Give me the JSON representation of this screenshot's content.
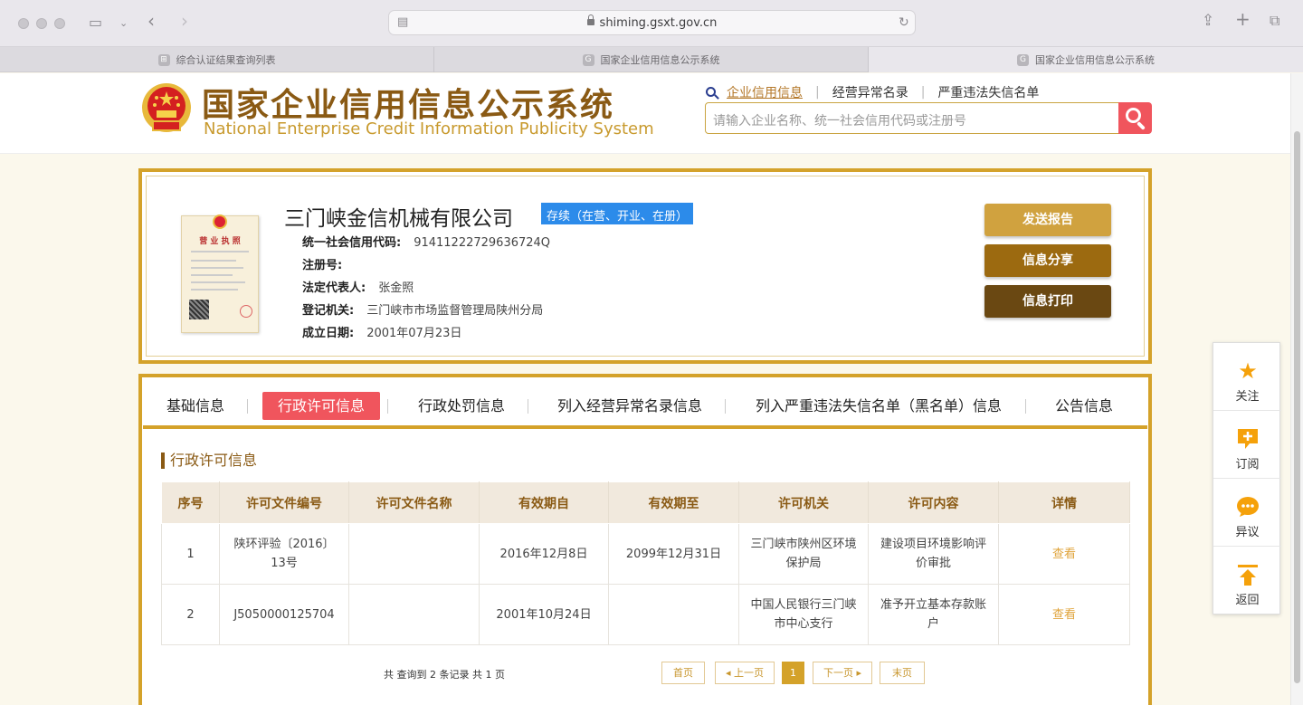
{
  "browser": {
    "url": "shiming.gsxt.gov.cn",
    "tabs": [
      {
        "label": "综合认证结果查询列表",
        "fav": "⊞"
      },
      {
        "label": "国家企业信用信息公示系统",
        "fav": "G"
      },
      {
        "label": "国家企业信用信息公示系统",
        "fav": "G"
      }
    ]
  },
  "header": {
    "logo_cn": "国家企业信用信息公示系统",
    "logo_en": "National Enterprise Credit Information Publicity System",
    "nav": [
      "企业信用信息",
      "经营异常名录",
      "严重违法失信名单"
    ],
    "search_placeholder": "请输入企业名称、统一社会信用代码或注册号"
  },
  "company": {
    "name": "三门峡金信机械有限公司",
    "status": "存续（在营、开业、在册）",
    "fields": [
      {
        "label": "统一社会信用代码:",
        "value": "91411222729636724Q"
      },
      {
        "label": "注册号:",
        "value": ""
      },
      {
        "label": "法定代表人:",
        "value": "张金照"
      },
      {
        "label": "登记机关:",
        "value": "三门峡市市场监督管理局陕州分局"
      },
      {
        "label": "成立日期:",
        "value": "2001年07月23日"
      }
    ],
    "license_title": "营 业 执 照",
    "actions": [
      "发送报告",
      "信息分享",
      "信息打印"
    ]
  },
  "tabs": [
    "基础信息",
    "行政许可信息",
    "行政处罚信息",
    "列入经营异常名录信息",
    "列入严重违法失信名单（黑名单）信息",
    "公告信息"
  ],
  "section_title": "行政许可信息",
  "table": {
    "headers": [
      "序号",
      "许可文件编号",
      "许可文件名称",
      "有效期自",
      "有效期至",
      "许可机关",
      "许可内容",
      "详情"
    ],
    "rows": [
      [
        "1",
        "陕环评验〔2016〕13号",
        "",
        "2016年12月8日",
        "2099年12月31日",
        "三门峡市陕州区环境保护局",
        "建设项目环境影响评价审批",
        "查看"
      ],
      [
        "2",
        "J5050000125704",
        "",
        "2001年10月24日",
        "",
        "中国人民银行三门峡市中心支行",
        "准予开立基本存款账户",
        "查看"
      ]
    ]
  },
  "pager": {
    "summary": "共 查询到 2 条记录 共 1 页",
    "buttons": [
      "首页",
      "◂ 上一页",
      "1",
      "下一页 ▸",
      "末页"
    ]
  },
  "sidebar": [
    {
      "label": "关注",
      "icon": "star-icon"
    },
    {
      "label": "订阅",
      "icon": "subscribe-icon"
    },
    {
      "label": "异议",
      "icon": "chat-icon"
    },
    {
      "label": "返回",
      "icon": "back-to-top-icon"
    }
  ],
  "colors": {
    "gold": "#d4a22a",
    "red": "#f0555d",
    "brown": "#8a5a14",
    "blue": "#2c8bea"
  }
}
